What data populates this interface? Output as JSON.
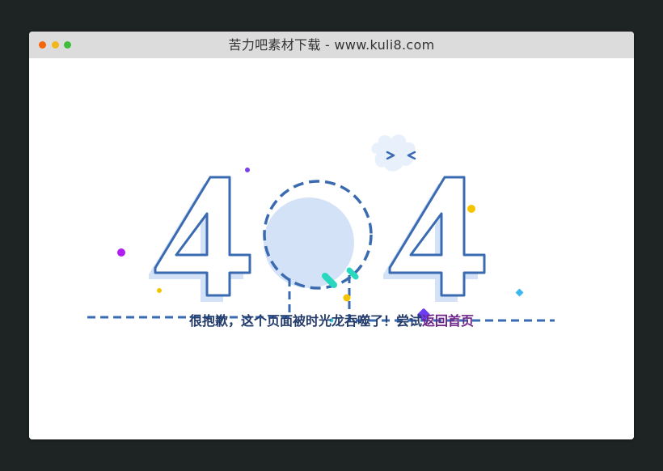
{
  "window": {
    "title": "苦力吧素材下载 - www.kuli8.com"
  },
  "error": {
    "code_digit_1": "4",
    "code_digit_3": "4",
    "message": "很抱歉，这个页面被时光龙吞噬了！尝试",
    "home_link": "返回首页"
  },
  "colors": {
    "outline": "#3a6bb0",
    "fill": "#d4e2f7",
    "message": "#253c6b",
    "link": "#6d2588"
  }
}
